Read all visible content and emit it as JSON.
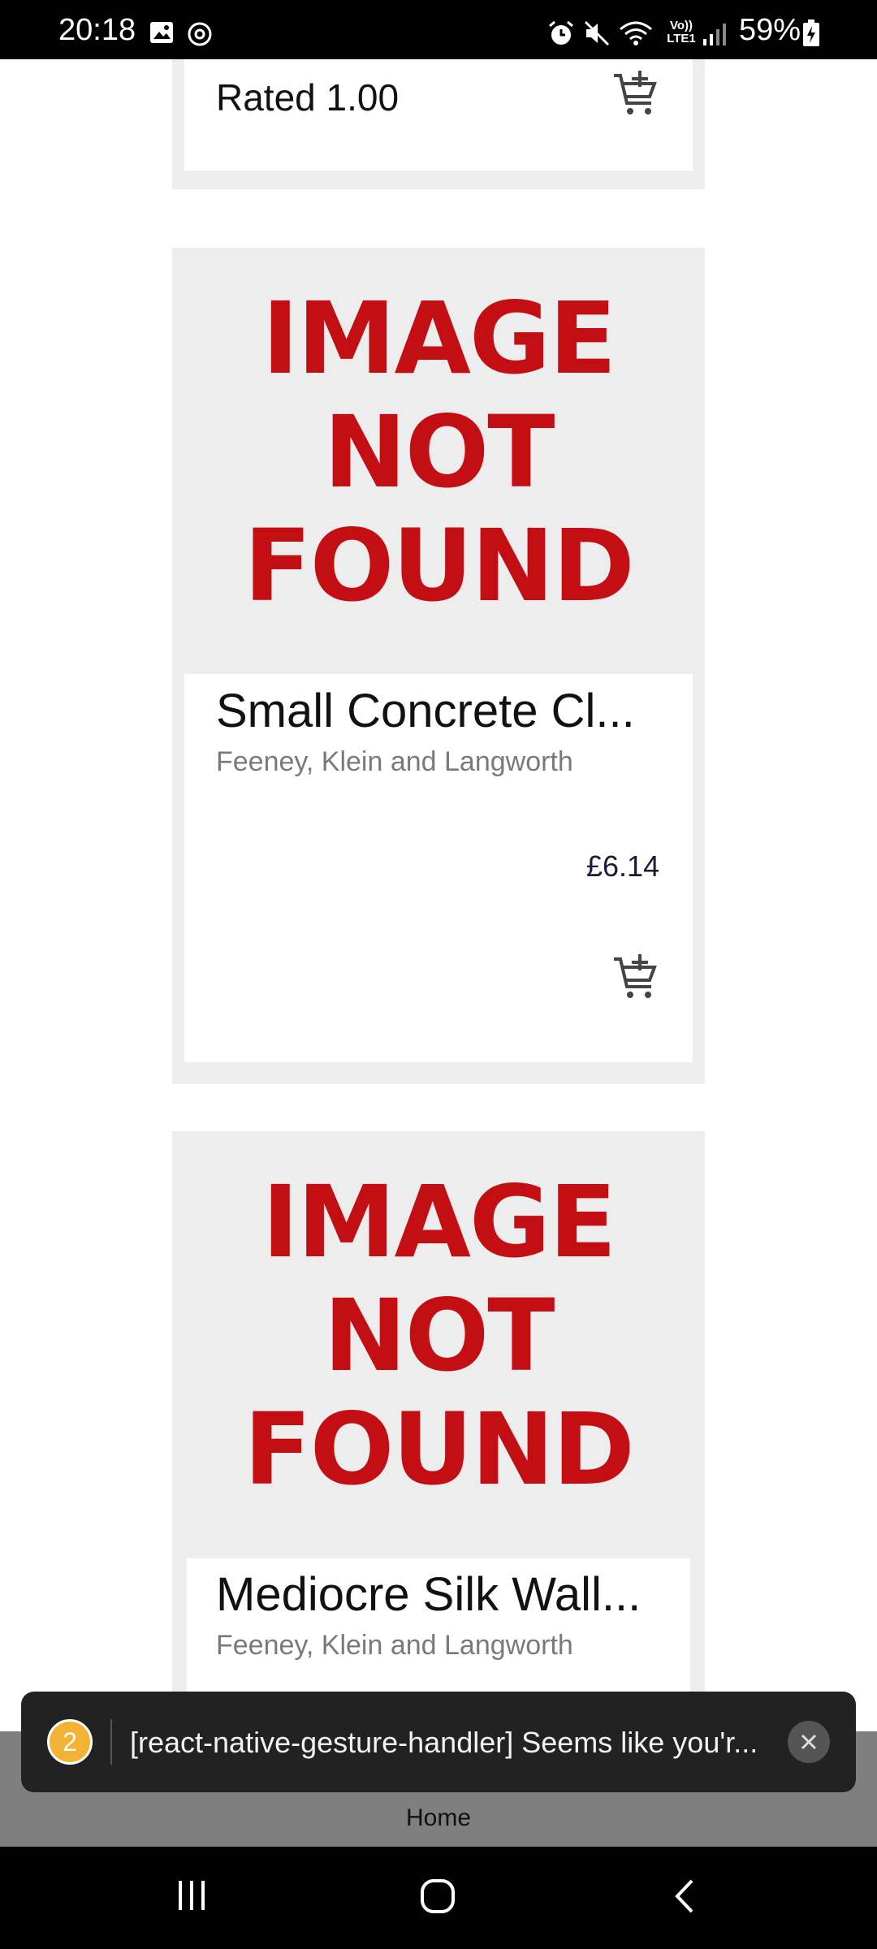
{
  "status_bar": {
    "time": "20:18",
    "battery": "59%",
    "left_icons": [
      "image-icon",
      "sync-icon"
    ],
    "right_icons": [
      "alarm-icon",
      "mute-icon",
      "wifi-icon",
      "volte-icon",
      "signal-icon",
      "battery-icon"
    ],
    "volte_text_top": "Vo))",
    "volte_text_bottom": "LTE1"
  },
  "products": [
    {
      "rating_text": "Rated 1.00"
    },
    {
      "image_placeholder": [
        "IMAGE",
        "NOT",
        "FOUND"
      ],
      "title": "Small Concrete Cl...",
      "brand": "Feeney, Klein and Langworth",
      "price": "£6.14"
    },
    {
      "image_placeholder": [
        "IMAGE",
        "NOT",
        "FOUND"
      ],
      "title": "Mediocre Silk Wall...",
      "brand": "Feeney, Klein and Langworth"
    }
  ],
  "toast": {
    "count": "2",
    "message": "[react-native-gesture-handler] Seems like you'r..."
  },
  "tab_bar": {
    "label": "Home"
  },
  "colors": {
    "placeholder_red": "#c30e14",
    "toast_badge": "#f2b233",
    "tab_bar": "#7f7f7f"
  }
}
